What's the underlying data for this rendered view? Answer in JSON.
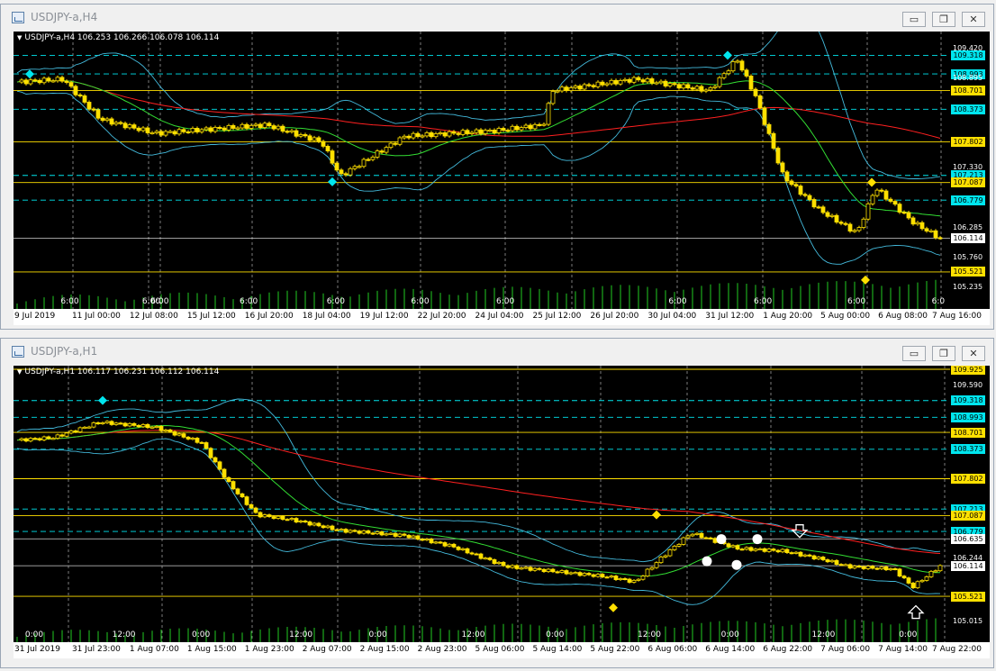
{
  "top": {
    "title": "USDJPY-a,H4",
    "header": "USDJPY-a,H4  106.253 106.266 106.078 106.114",
    "price_scale": [
      {
        "label": "109.420",
        "kind": "plain",
        "price": 109.42
      },
      {
        "label": "109.318",
        "kind": "cyan",
        "price": 109.318
      },
      {
        "label": "108.993",
        "kind": "cyan",
        "price": 108.993
      },
      {
        "label": "108.895",
        "kind": "plain",
        "price": 108.895
      },
      {
        "label": "108.701",
        "kind": "yellow",
        "price": 108.701
      },
      {
        "label": "108.373",
        "kind": "cyan",
        "price": 108.373
      },
      {
        "label": "107.802",
        "kind": "yellow",
        "price": 107.802
      },
      {
        "label": "107.330",
        "kind": "plain",
        "price": 107.33
      },
      {
        "label": "107.213",
        "kind": "cyan",
        "price": 107.213
      },
      {
        "label": "107.087",
        "kind": "yellow",
        "price": 107.087
      },
      {
        "label": "106.779",
        "kind": "cyan",
        "price": 106.779
      },
      {
        "label": "106.285",
        "kind": "plain",
        "price": 106.285
      },
      {
        "label": "106.114",
        "kind": "white",
        "price": 106.114
      },
      {
        "label": "105.760",
        "kind": "plain",
        "price": 105.76
      },
      {
        "label": "105.521",
        "kind": "yellow",
        "price": 105.521
      },
      {
        "label": "105.235",
        "kind": "plain",
        "price": 105.235
      }
    ],
    "time_labels": [
      {
        "text": "6:00",
        "pos": 0.06
      },
      {
        "text": "6:00",
        "pos": 0.147
      },
      {
        "text": "6:00",
        "pos": 0.156
      },
      {
        "text": "6:00",
        "pos": 0.251
      },
      {
        "text": "6:00",
        "pos": 0.344
      },
      {
        "text": "6:00",
        "pos": 0.434
      },
      {
        "text": "6:00",
        "pos": 0.525
      },
      {
        "text": "6:00",
        "pos": 0.709
      },
      {
        "text": "6:00",
        "pos": 0.8
      },
      {
        "text": "6:00",
        "pos": 0.9
      },
      {
        "text": "6:0",
        "pos": 0.99
      }
    ],
    "dates": [
      "9 Jul 2019",
      "11 Jul 00:00",
      "12 Jul 08:00",
      "15 Jul 12:00",
      "16 Jul 20:00",
      "18 Jul 04:00",
      "19 Jul 12:00",
      "22 Jul 20:00",
      "24 Jul 04:00",
      "25 Jul 12:00",
      "26 Jul 20:00",
      "30 Jul 04:00",
      "31 Jul 12:00",
      "1 Aug 20:00",
      "5 Aug 00:00",
      "6 Aug 08:00",
      "7 Aug 16:00"
    ]
  },
  "bottom": {
    "title": "USDJPY-a,H1",
    "header": "USDJPY-a,H1  106.117 106.231 106.112 106.114",
    "price_scale": [
      {
        "label": "109.925",
        "kind": "yellow",
        "price": 109.925
      },
      {
        "label": "109.590",
        "kind": "plain",
        "price": 109.59
      },
      {
        "label": "109.318",
        "kind": "cyan",
        "price": 109.318
      },
      {
        "label": "108.993",
        "kind": "cyan",
        "price": 108.993
      },
      {
        "label": "108.701",
        "kind": "yellow",
        "price": 108.701
      },
      {
        "label": "108.373",
        "kind": "cyan",
        "price": 108.373
      },
      {
        "label": "107.802",
        "kind": "yellow",
        "price": 107.802
      },
      {
        "label": "107.213",
        "kind": "cyan",
        "price": 107.213
      },
      {
        "label": "107.087",
        "kind": "yellow",
        "price": 107.087
      },
      {
        "label": "106.779",
        "kind": "cyan",
        "price": 106.779
      },
      {
        "label": "106.635",
        "kind": "white",
        "price": 106.635
      },
      {
        "label": "106.244",
        "kind": "plain",
        "price": 106.244
      },
      {
        "label": "106.114",
        "kind": "white",
        "price": 106.114
      },
      {
        "label": "105.521",
        "kind": "yellow",
        "price": 105.521
      },
      {
        "label": "105.015",
        "kind": "plain",
        "price": 105.015
      }
    ],
    "time_labels": [
      {
        "text": "0:00",
        "pos": 0.022
      },
      {
        "text": "12:00",
        "pos": 0.115
      },
      {
        "text": "0:00",
        "pos": 0.2
      },
      {
        "text": "12:00",
        "pos": 0.304
      },
      {
        "text": "0:00",
        "pos": 0.389
      },
      {
        "text": "12:00",
        "pos": 0.488
      },
      {
        "text": "0:00",
        "pos": 0.578
      },
      {
        "text": "12:00",
        "pos": 0.676
      },
      {
        "text": "0:00",
        "pos": 0.765
      },
      {
        "text": "12:00",
        "pos": 0.862
      },
      {
        "text": "0:00",
        "pos": 0.955
      }
    ],
    "dates": [
      "31 Jul 2019",
      "31 Jul 23:00",
      "1 Aug 07:00",
      "1 Aug 15:00",
      "1 Aug 23:00",
      "2 Aug 07:00",
      "2 Aug 15:00",
      "2 Aug 23:00",
      "5 Aug 06:00",
      "5 Aug 14:00",
      "5 Aug 22:00",
      "6 Aug 06:00",
      "6 Aug 14:00",
      "6 Aug 22:00",
      "7 Aug 06:00",
      "7 Aug 14:00",
      "7 Aug 22:00"
    ]
  },
  "window_buttons": {
    "minimize": "▭",
    "restore": "❐",
    "close": "✕"
  },
  "colors": {
    "cyan": "#00e5ee",
    "yellow": "#ffe000",
    "ma_slow": "#ff2020",
    "ma_fast": "#33dd33",
    "bands": "#44bbdd",
    "volume": "#22cc22"
  }
}
